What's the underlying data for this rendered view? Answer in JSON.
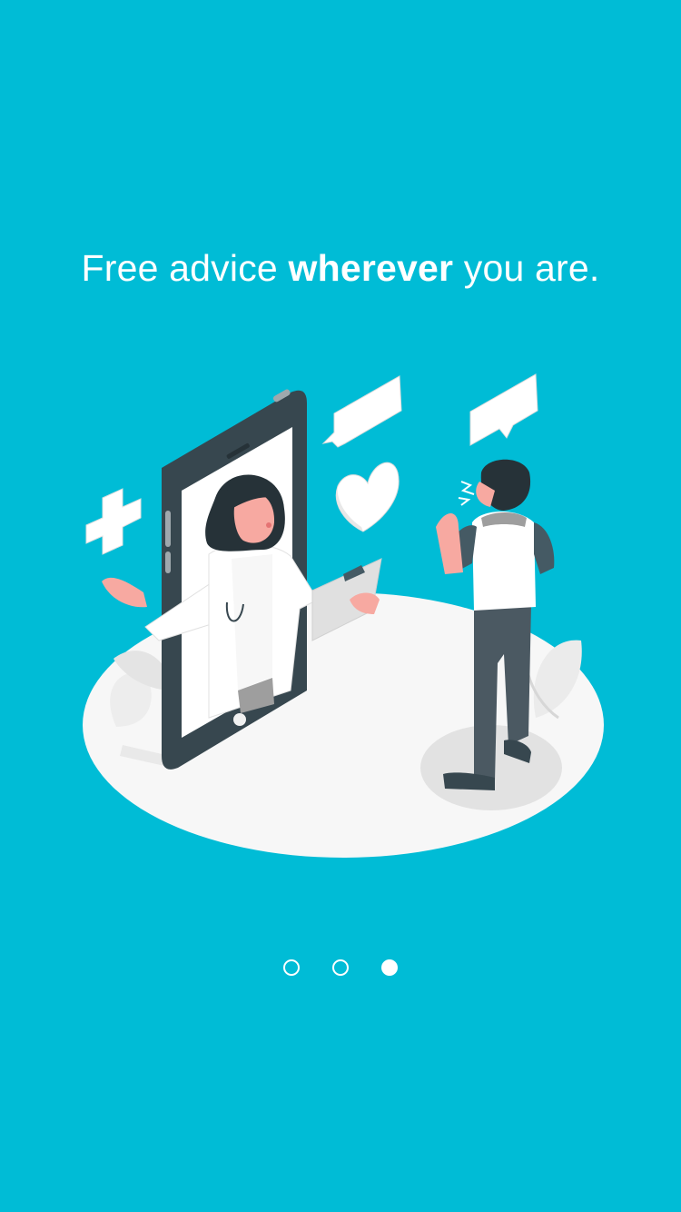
{
  "colors": {
    "background": "#00BCD6",
    "text": "#FFFFFF",
    "dot": "#FFFFFF"
  },
  "headline": {
    "before": "Free advice ",
    "emphasis": "wherever",
    "after": " you are."
  },
  "pager": {
    "total": 3,
    "active_index": 2
  },
  "illustration": {
    "icons": [
      "smartphone-icon",
      "doctor-icon",
      "patient-icon",
      "heart-icon",
      "plus-icon",
      "speech-bubble-icon",
      "clipboard-icon"
    ]
  }
}
